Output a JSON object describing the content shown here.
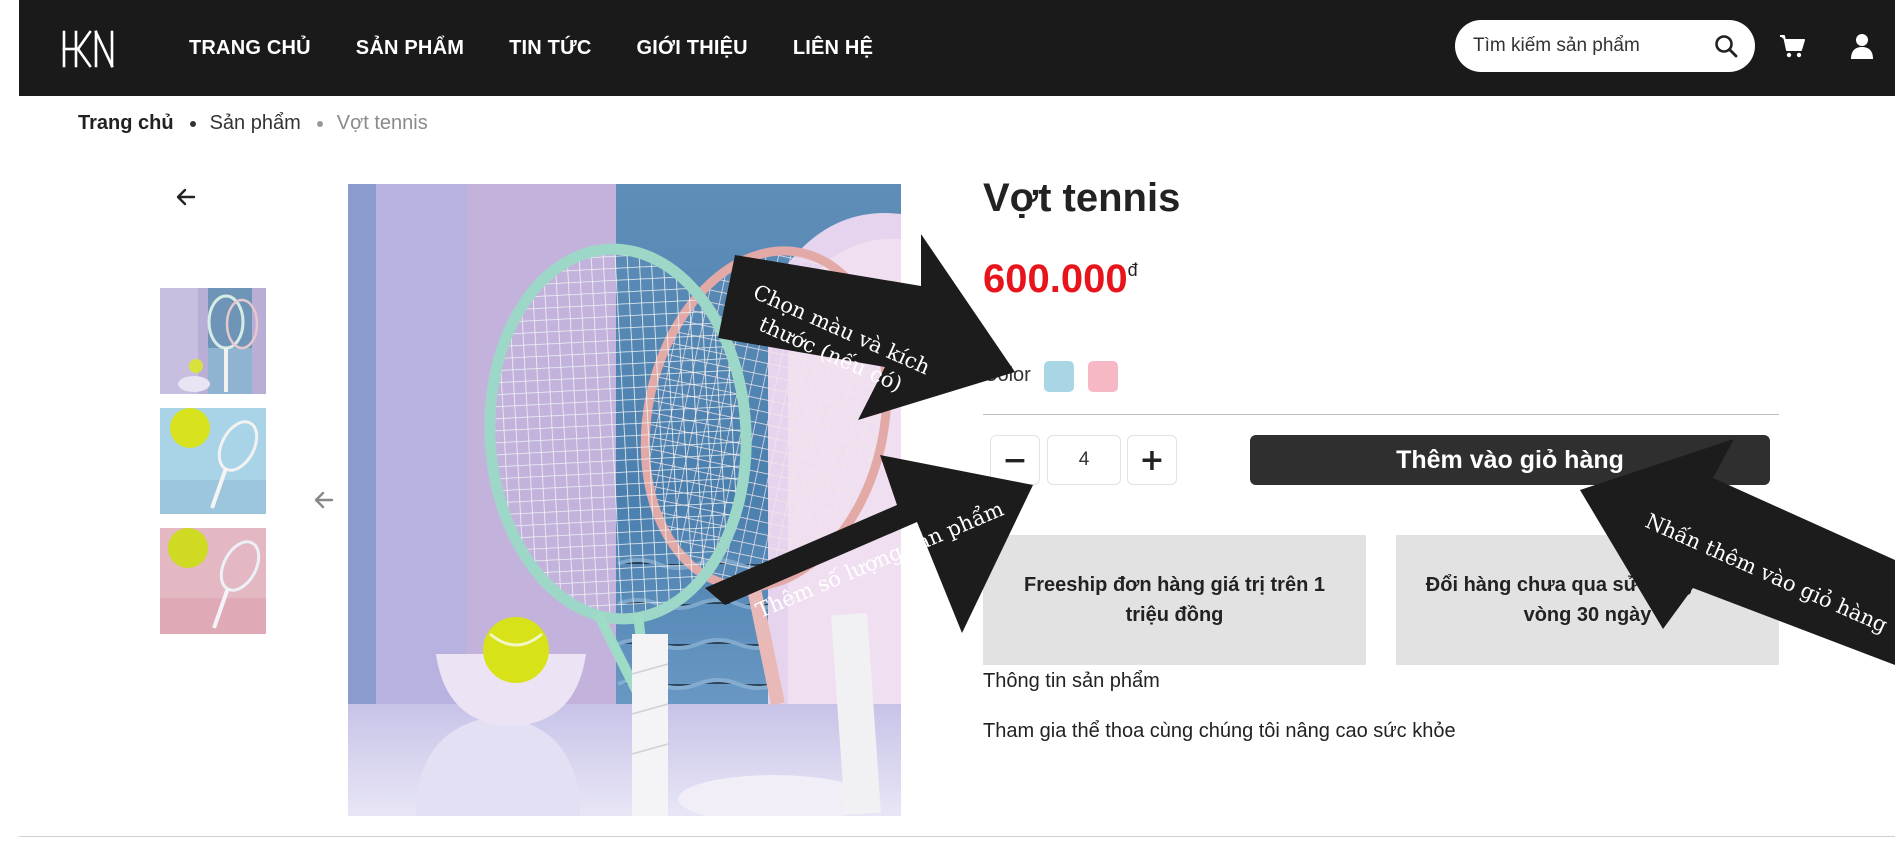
{
  "header": {
    "logo_text": "HKN",
    "nav": [
      "TRANG CHỦ",
      "SẢN PHẨM",
      "TIN TỨC",
      "GIỚI THIỆU",
      "LIÊN HỆ"
    ],
    "search_placeholder": "Tìm kiếm sản phẩm",
    "icons": {
      "search": "search-icon",
      "cart": "cart-icon",
      "user": "user-icon"
    }
  },
  "breadcrumb": {
    "home": "Trang chủ",
    "category": "Sản phẩm",
    "current": "Vợt tennis"
  },
  "product": {
    "title": "Vợt tennis",
    "price": "600.000",
    "currency": "đ",
    "color_label": "Color",
    "colors": [
      "#a9d6e5",
      "#f6b8c4"
    ],
    "quantity": "4",
    "minus_label": "−",
    "plus_label": "+",
    "add_to_cart": "Thêm vào giỏ hàng",
    "policies": [
      "Freeship đơn hàng giá trị trên 1 triệu đồng",
      "Đổi hàng chưa qua sử dụng trong vòng 30 ngày"
    ],
    "info_title": "Thông tin sản phẩm",
    "info_desc": "Tham gia thể thoa cùng chúng tôi nâng cao sức khỏe"
  },
  "annotations": {
    "choose_color": "Chọn màu và kích thước (nếu có)",
    "add_quantity": "Thêm số lượng sản phẩm",
    "press_add": "Nhấn thêm vào giỏ hàng"
  },
  "colors": {
    "header_bg": "#1a1a1a",
    "price": "#e8141c",
    "button_bg": "#2f2f2f",
    "policy_bg": "#e2e2e2",
    "arrow": "#1c1c1c"
  }
}
